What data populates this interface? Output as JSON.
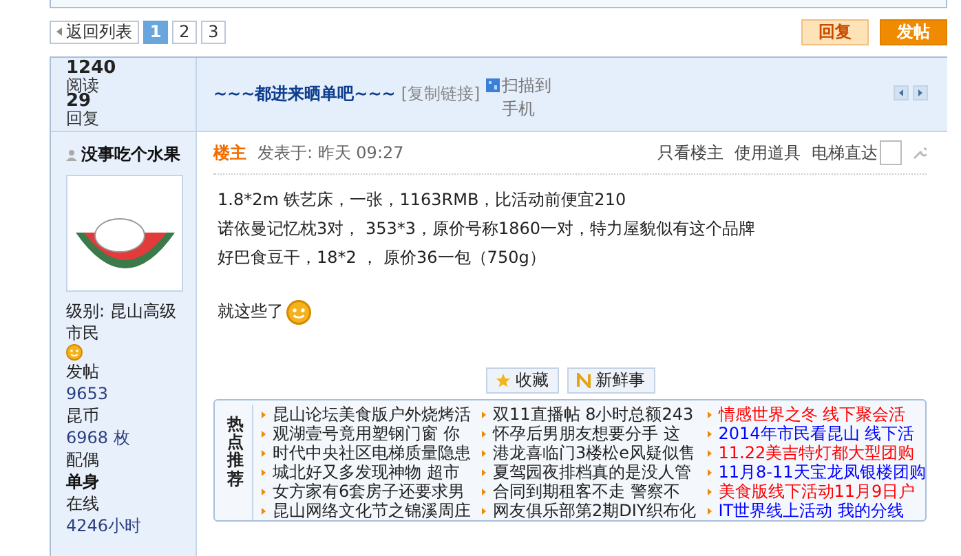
{
  "pager": {
    "back": "返回列表",
    "pages": [
      {
        "label": "1",
        "selected": true
      },
      {
        "label": "2",
        "selected": false
      },
      {
        "label": "3",
        "selected": false
      }
    ]
  },
  "actions": [
    {
      "label": "回复",
      "kind": "reply"
    },
    {
      "label": "发帖",
      "kind": "post"
    }
  ],
  "thread": {
    "views": "1240",
    "views_label": "阅读",
    "replies": "29",
    "replies_label": "回复",
    "title": "~~~都进来晒单吧~~~",
    "copy_link": "[复制链接]",
    "scan": "扫描到手机"
  },
  "author": {
    "name": "没事吃个水果",
    "level": "级别: 昆山高级市民",
    "stats": [
      {
        "label": "发帖",
        "value": "9653",
        "kind": "number"
      },
      {
        "label": "昆币",
        "value": "6968",
        "unit": " 枚",
        "kind": "number"
      },
      {
        "label": "配偶",
        "value": "单身",
        "kind": "text"
      },
      {
        "label": "在线",
        "value": "4246",
        "unit": "小时",
        "kind": "number"
      }
    ]
  },
  "post": {
    "badge": "楼主",
    "time": "发表于: 昨天 09:27",
    "tools": [
      "只看楼主",
      "使用道具",
      "电梯直达"
    ],
    "lines": [
      "1.8*2m 铁艺床，一张，1163RMB，比活动前便宜210",
      "诺依曼记忆枕3对， 353*3，原价号称1860一对，特力屋貌似有这个品牌",
      "好巴食豆干，18*2 ， 原价36一包（750g）"
    ],
    "closing": "就这些了",
    "buttons": [
      {
        "label": "收藏",
        "kind": "favorite"
      },
      {
        "label": "新鲜事",
        "kind": "news"
      }
    ]
  },
  "hot": {
    "label": "热点推荐",
    "columns": [
      [
        {
          "text": "昆山论坛美食版户外烧烤活",
          "color": "#222222"
        },
        {
          "text": "观湖壹号竟用塑钢门窗 你",
          "color": "#222222"
        },
        {
          "text": "时代中央社区电梯质量隐患",
          "color": "#222222"
        },
        {
          "text": "城北好又多发现神物 超市",
          "color": "#222222"
        },
        {
          "text": "女方家有6套房子还要求男",
          "color": "#222222"
        },
        {
          "text": "昆山网络文化节之锦溪周庄",
          "color": "#222222"
        }
      ],
      [
        {
          "text": "双11直播帖 8小时总额243",
          "color": "#222222"
        },
        {
          "text": "怀孕后男朋友想要分手 这",
          "color": "#222222"
        },
        {
          "text": "港龙喜临门3楼松e风疑似售",
          "color": "#222222"
        },
        {
          "text": "夏驾园夜排档真的是没人管",
          "color": "#222222"
        },
        {
          "text": "合同到期租客不走 警察不",
          "color": "#222222"
        },
        {
          "text": "网友俱乐部第2期DIY织布化",
          "color": "#222222"
        }
      ],
      [
        {
          "text": "情感世界之冬 线下聚会活",
          "color": "#ff0000"
        },
        {
          "text": "2014年市民看昆山 线下活",
          "color": "#0000ff"
        },
        {
          "text": "11.22美吉特灯都大型团购",
          "color": "#ff0000"
        },
        {
          "text": "11月8-11天宝龙凤银楼团购",
          "color": "#0000ff"
        },
        {
          "text": "美食版线下活动11月9日户",
          "color": "#ff0000"
        },
        {
          "text": "IT世界线上活动 我的分线",
          "color": "#0000ff"
        }
      ]
    ]
  }
}
